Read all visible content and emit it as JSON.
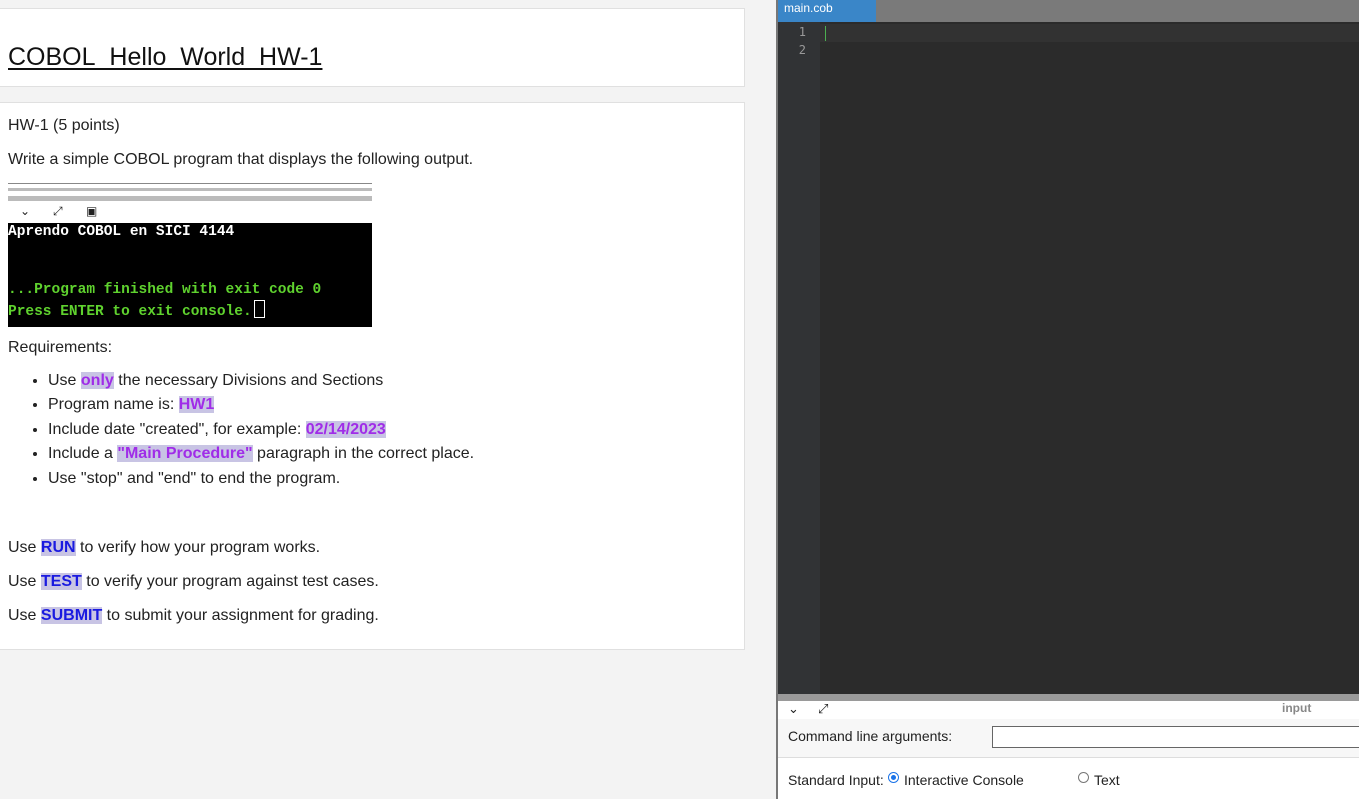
{
  "assignment": {
    "title": "COBOL_Hello_World_HW-1",
    "heading": "HW-1 (5 points)",
    "intro": "Write a simple COBOL program that displays the following output.",
    "console_image": {
      "line1": "Aprendo COBOL en SICI 4144",
      "line2": "...Program finished with exit code 0",
      "line3": "Press ENTER to exit console."
    },
    "requirements_label": "Requirements:",
    "requirements": [
      {
        "pre": "Use ",
        "hl": "only",
        "post": " the necessary Divisions and Sections"
      },
      {
        "pre": "Program name is: ",
        "hl": "HW1",
        "post": ""
      },
      {
        "pre": "Include date \"created\", for example: ",
        "hl": "02/14/2023",
        "post": ""
      },
      {
        "pre": "Include a ",
        "hl": "\"Main Procedure\"",
        "post": " paragraph in the correct place."
      },
      {
        "pre": "Use \"stop\" and \"end\" to end the program.",
        "hl": "",
        "post": ""
      }
    ],
    "actions": [
      {
        "pre": "Use ",
        "hl": "RUN",
        "post": " to verify how your program works."
      },
      {
        "pre": "Use ",
        "hl": "TEST",
        "post": " to verify your program against test cases."
      },
      {
        "pre": "Use ",
        "hl": "SUBMIT",
        "post": " to submit your assignment for grading."
      }
    ]
  },
  "editor": {
    "tab_label": "main.cob",
    "line_numbers": [
      "1",
      "2"
    ]
  },
  "io_panel": {
    "input_label": "input",
    "cmd_args_label": "Command line arguments:",
    "cmd_args_value": "",
    "stdin_label": "Standard Input:",
    "option_interactive": "Interactive Console",
    "option_text": "Text",
    "selected": "Interactive Console"
  },
  "colors": {
    "highlight_bg": "#c8c4e4",
    "purple_text": "#a02ce8",
    "blue_text": "#1a1ae0",
    "console_green": "#5fd22e",
    "tab_blue": "#3a86c8",
    "editor_bg": "#2b2b2b"
  }
}
